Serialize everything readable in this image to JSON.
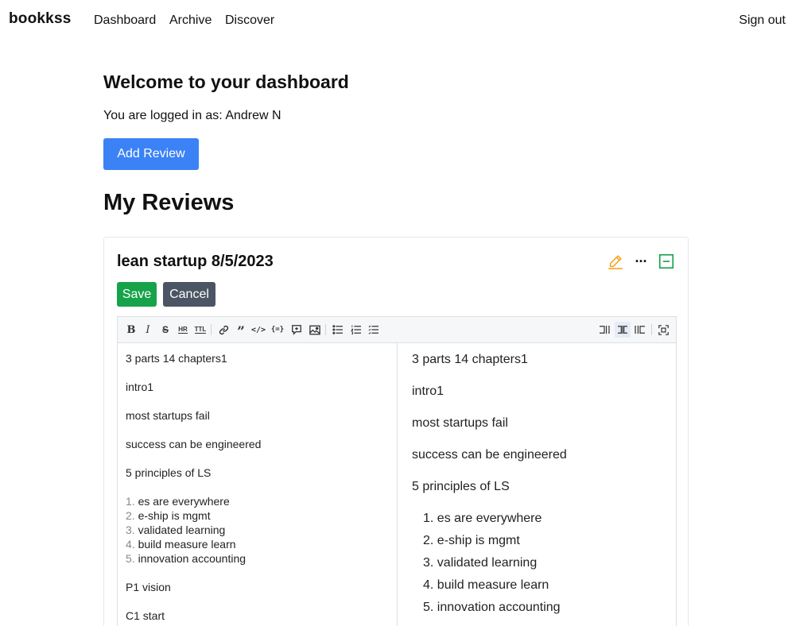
{
  "nav": {
    "brand": "bookkss",
    "links": [
      "Dashboard",
      "Archive",
      "Discover"
    ],
    "sign_out": "Sign out"
  },
  "dashboard": {
    "welcome": "Welcome to your dashboard",
    "logged_in": "You are logged in as: Andrew N",
    "add_review": "Add Review",
    "my_reviews": "My Reviews"
  },
  "review": {
    "title": "lean startup 8/5/2023",
    "save_label": "Save",
    "cancel_label": "Cancel",
    "ellipsis": "···"
  },
  "editor": {
    "toolbar": {
      "bold": "B",
      "italic": "I",
      "strike": "S",
      "hr": "HR",
      "title": "TTL",
      "quote": "”",
      "code": "</>",
      "codeblock": "{=}"
    },
    "source_lines": [
      "3 parts 14 chapters1",
      "intro1",
      "most startups fail",
      "success can be engineered",
      "5 principles of LS"
    ],
    "source_list": [
      {
        "num": "1.",
        "text": "es are everywhere"
      },
      {
        "num": "2.",
        "text": "e-ship is mgmt"
      },
      {
        "num": "3.",
        "text": "validated learning"
      },
      {
        "num": "4.",
        "text": "build measure learn"
      },
      {
        "num": "5.",
        "text": "innovation accounting"
      }
    ],
    "source_tail": [
      "P1 vision",
      "C1 start"
    ],
    "preview_lines": [
      "3 parts 14 chapters1",
      "intro1",
      "most startups fail",
      "success can be engineered",
      "5 principles of LS"
    ],
    "preview_list": [
      "1. es are everywhere",
      "2. e-ship is mgmt",
      "3. validated learning",
      "4. build measure learn",
      "5. innovation accounting"
    ]
  },
  "colors": {
    "primary": "#3b82f6",
    "save": "#16a34a",
    "cancel": "#4b5563",
    "edit_icon": "#f59e0b",
    "collapse_icon": "#16a34a"
  }
}
